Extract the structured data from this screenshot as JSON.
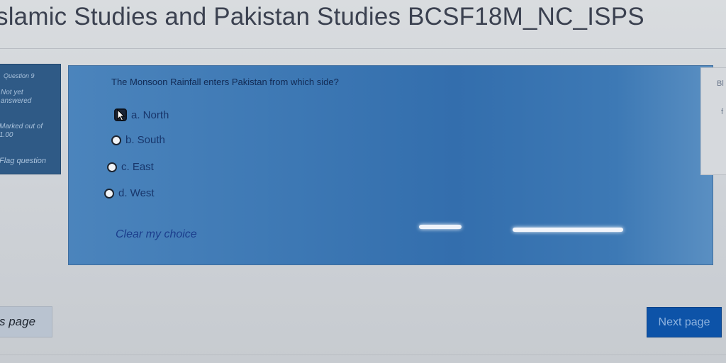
{
  "course": {
    "title": "slamic Studies and Pakistan Studies BCSF18M_NC_ISPS"
  },
  "info": {
    "question_no": "Question 9",
    "state": "Not yet answered",
    "marks": "Marked out of 1.00",
    "flag_label": "Flag question"
  },
  "question": {
    "text": "The Monsoon Rainfall enters Pakistan from which side?",
    "options": [
      {
        "label": "a. North",
        "selected": true
      },
      {
        "label": "b. South",
        "selected": false
      },
      {
        "label": "c. East",
        "selected": false
      },
      {
        "label": "d. West",
        "selected": false
      }
    ],
    "clear_label": "Clear my choice"
  },
  "nav": {
    "prev_label": "s page",
    "next_label": "Next page"
  },
  "right_panel": {
    "text_1": "Bl",
    "text_2": "f"
  },
  "colors": {
    "question_bg": "#3d78b4",
    "next_button": "#0d53a8",
    "info_bg": "#2f5a86"
  }
}
